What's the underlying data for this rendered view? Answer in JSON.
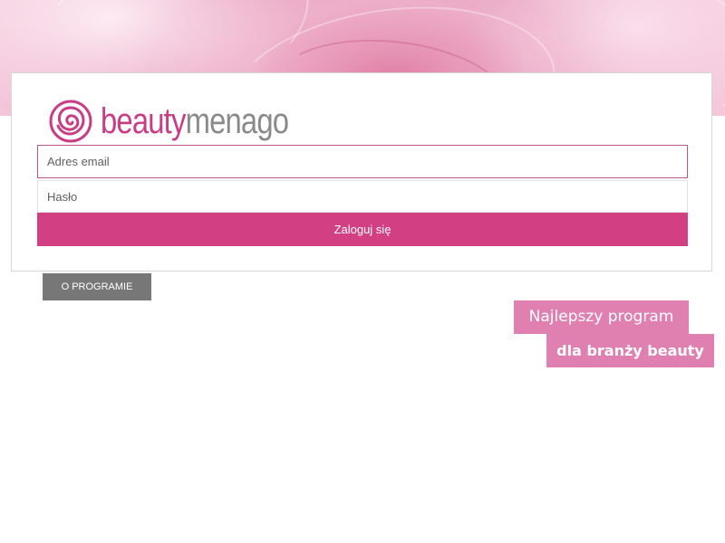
{
  "brand": {
    "name_part1": "beauty",
    "name_part2": "menago",
    "color_primary": "#c83d86",
    "color_secondary": "#8a8a8a",
    "icon": "rose-logo-icon"
  },
  "login": {
    "email_placeholder": "Adres email",
    "password_placeholder": "Hasło",
    "submit_label": "Zaloguj się"
  },
  "about_button": {
    "label": "O PROGRAMIE"
  },
  "tagline": {
    "line1": "Najlepszy program",
    "line2": "dla branży beauty"
  },
  "colors": {
    "accent": "#d23f83",
    "tag_bg": "#e080b0",
    "about_bg": "#777777"
  }
}
